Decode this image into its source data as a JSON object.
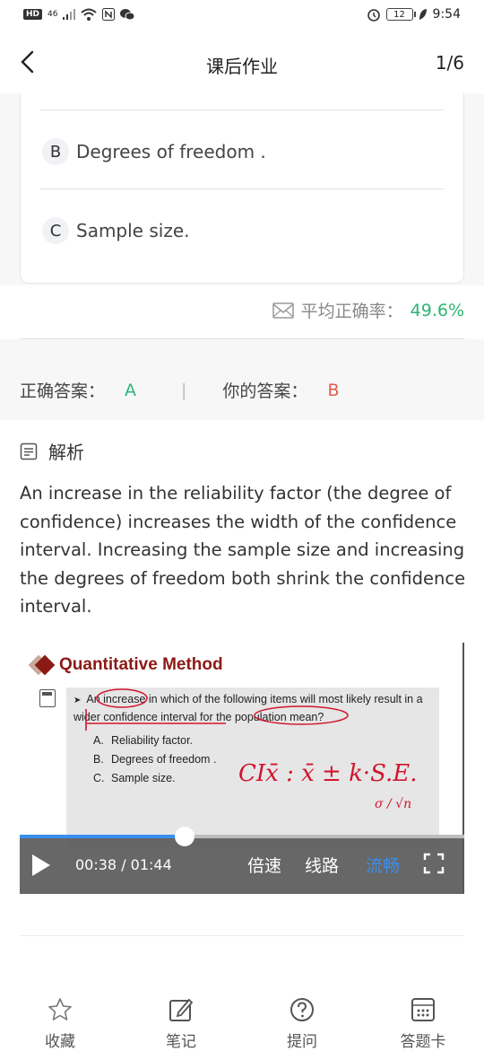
{
  "status_bar": {
    "left_chip": "HD",
    "network": "46",
    "battery": "12",
    "time": "9:54"
  },
  "nav": {
    "title": "课后作业",
    "progress": "1/6"
  },
  "options": [
    {
      "letter": "B",
      "text": "Degrees of freedom ."
    },
    {
      "letter": "C",
      "text": "Sample size."
    }
  ],
  "accuracy": {
    "label": "平均正确率：",
    "value": "49.6%"
  },
  "answers": {
    "correct_label": "正确答案：",
    "correct_value": "A",
    "separator": "|",
    "mine_label": "你的答案：",
    "mine_value": "B"
  },
  "analysis": {
    "heading": "解析",
    "text": "An increase in the reliability factor (the degree of confidence) increases the width of the confidence interval. Increasing the sample size and increasing the degrees of freedom both shrink the confidence interval."
  },
  "video": {
    "slide_title": "Quantitative Method",
    "question": "An increase in which of the following items will most likely result in a wider confidence interval for the population mean?",
    "slide_options": [
      {
        "letter": "A.",
        "text": "Reliability factor."
      },
      {
        "letter": "B.",
        "text": "Degrees of freedom ."
      },
      {
        "letter": "C.",
        "text": "Sample size."
      }
    ],
    "handwriting": "CIx̄ : x̄ ± k·S.E.",
    "handwriting_sub": "σ / √n",
    "time": "00:38 / 01:44",
    "progress_fraction": 0.37,
    "speed": "倍速",
    "route": "线路",
    "quality": "流畅"
  },
  "tabs": [
    {
      "label": "收藏",
      "icon": "star-icon"
    },
    {
      "label": "笔记",
      "icon": "note-edit-icon"
    },
    {
      "label": "提问",
      "icon": "question-icon"
    },
    {
      "label": "答题卡",
      "icon": "answer-card-icon"
    }
  ],
  "colors": {
    "green": "#2bb673",
    "red": "#e05b4e",
    "blue": "#3a8ef0",
    "slide_red": "#8b1a14"
  }
}
